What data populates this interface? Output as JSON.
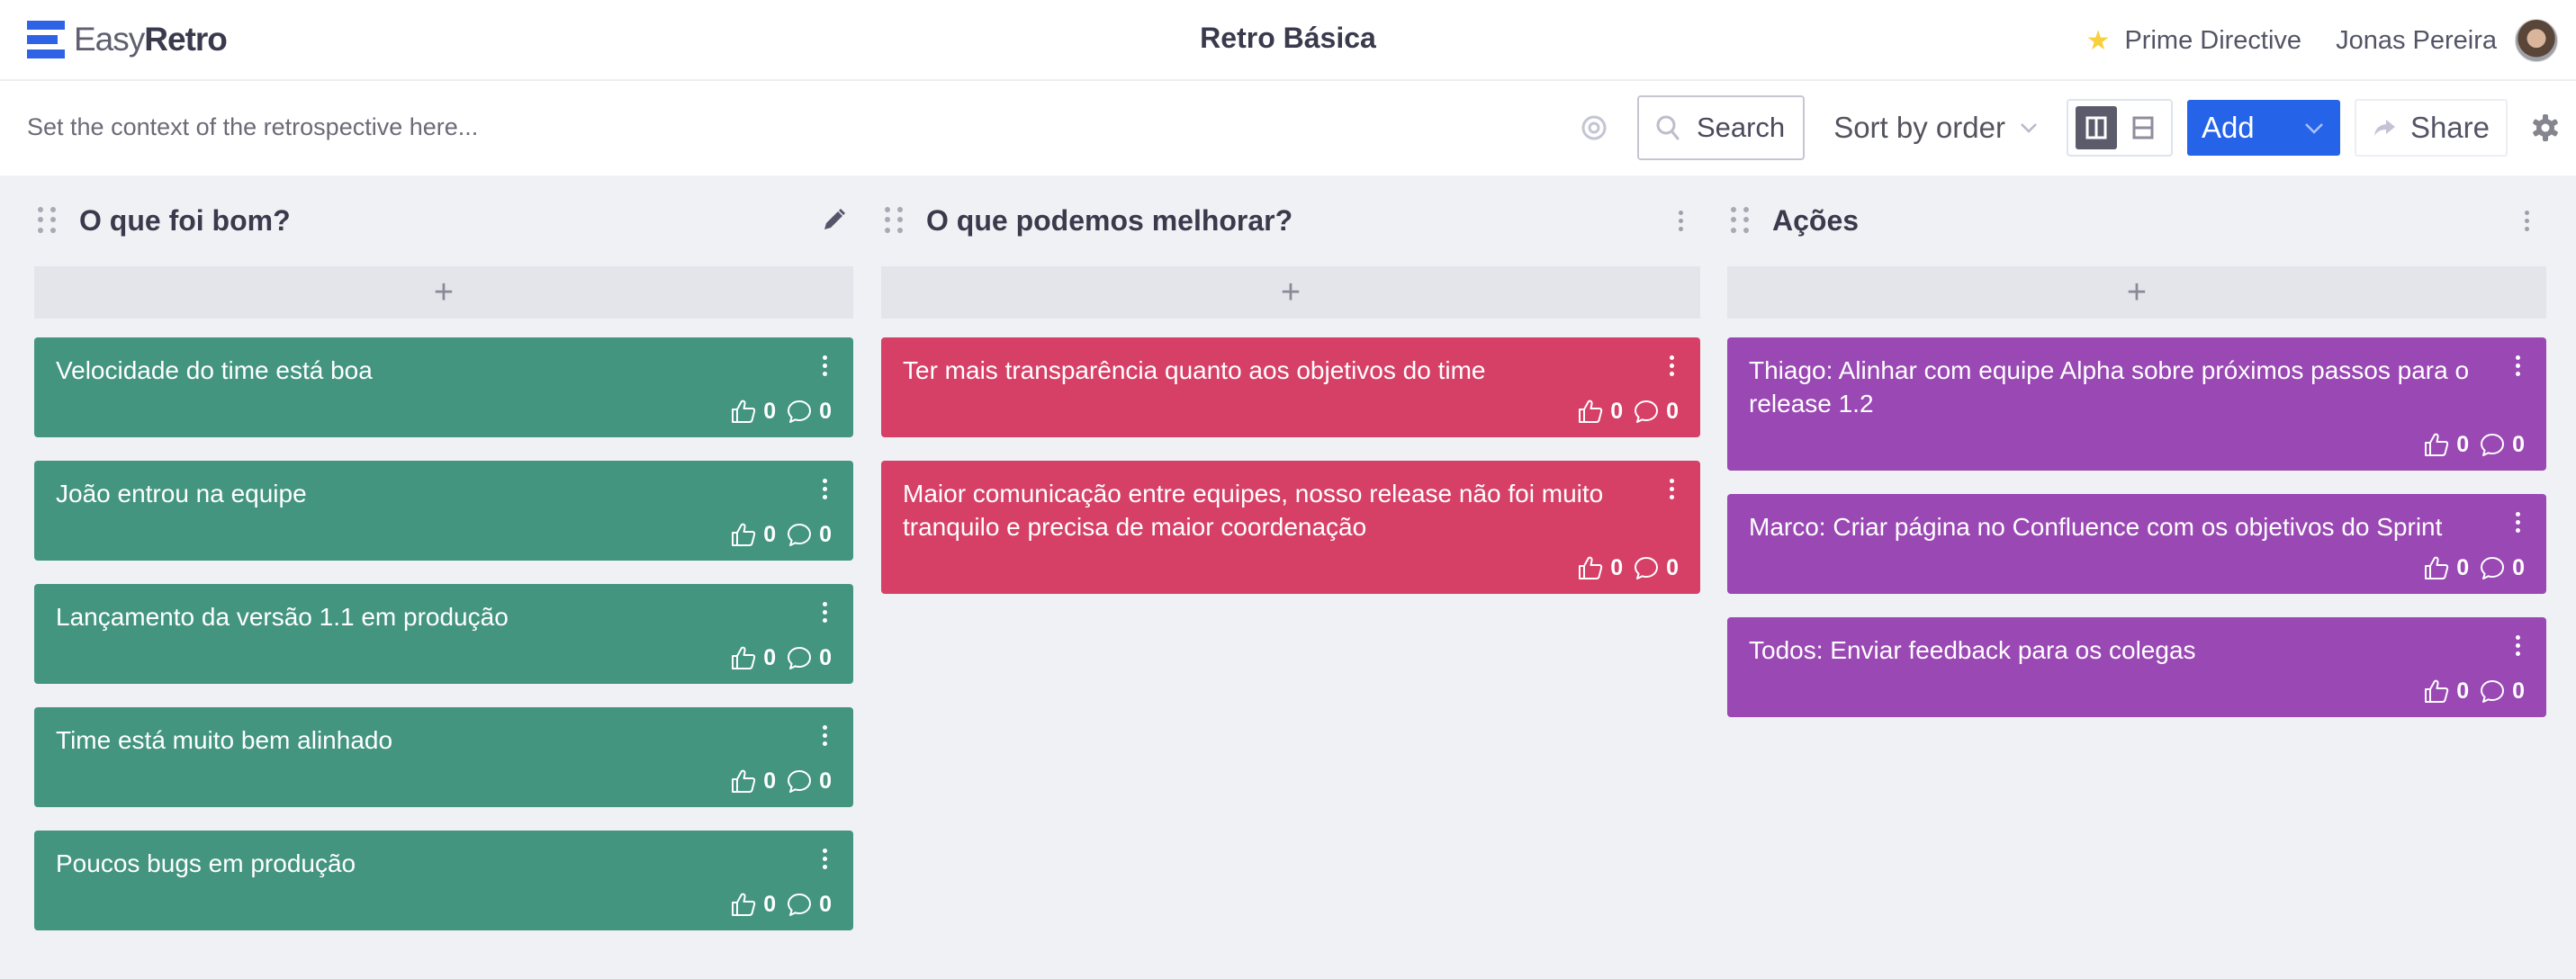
{
  "header": {
    "brand_light": "Easy",
    "brand_bold": "Retro",
    "board_title": "Retro Básica",
    "prime_directive_label": "Prime Directive",
    "user_name": "Jonas Pereira",
    "icons": {
      "prime": "star-icon",
      "avatar": "user-avatar"
    }
  },
  "toolbar": {
    "context_placeholder": "Set the context of the retrospective here...",
    "search_label": "Search",
    "sort_label": "Sort by order",
    "add_label": "Add",
    "share_label": "Share",
    "view_modes": [
      "columns",
      "rows"
    ],
    "active_view": "columns"
  },
  "colors": {
    "accent": "#2563e8",
    "column_good": "#43957f",
    "column_improve": "#d64067",
    "column_actions": "#9a48b4",
    "star": "#f8cf3c"
  },
  "columns": [
    {
      "title": "O que foi bom?",
      "color": "#43957f",
      "header_action": "edit",
      "add_label": "+",
      "cards": [
        {
          "text": "Velocidade do time está boa",
          "votes": "0",
          "comments": "0"
        },
        {
          "text": "João entrou na equipe",
          "votes": "0",
          "comments": "0"
        },
        {
          "text": "Lançamento da versão 1.1 em produção",
          "votes": "0",
          "comments": "0"
        },
        {
          "text": "Time está muito bem alinhado",
          "votes": "0",
          "comments": "0"
        },
        {
          "text": "Poucos bugs em produção",
          "votes": "0",
          "comments": "0"
        }
      ]
    },
    {
      "title": "O que podemos melhorar?",
      "color": "#d64067",
      "header_action": "menu",
      "add_label": "+",
      "cards": [
        {
          "text": "Ter mais transparência quanto aos objetivos do time",
          "votes": "0",
          "comments": "0"
        },
        {
          "text": "Maior comunicação entre equipes, nosso release não foi muito tranquilo e precisa de maior coordenação",
          "votes": "0",
          "comments": "0"
        }
      ]
    },
    {
      "title": "Ações",
      "color": "#9a48b4",
      "header_action": "menu",
      "add_label": "+",
      "cards": [
        {
          "text": "Thiago: Alinhar com equipe Alpha sobre próximos passos para o release 1.2",
          "votes": "0",
          "comments": "0"
        },
        {
          "text": "Marco: Criar página no Confluence com os objetivos do Sprint",
          "votes": "0",
          "comments": "0"
        },
        {
          "text": "Todos: Enviar feedback para os colegas",
          "votes": "0",
          "comments": "0"
        }
      ]
    }
  ]
}
